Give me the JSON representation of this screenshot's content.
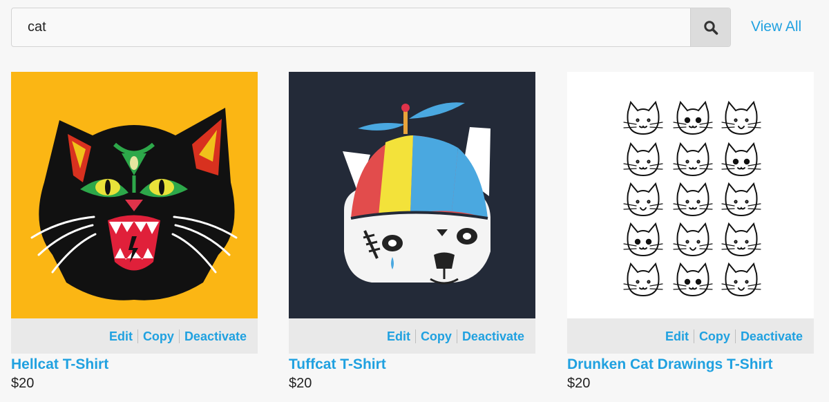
{
  "search": {
    "value": "cat",
    "button_icon": "search-icon"
  },
  "view_all_label": "View All",
  "products": [
    {
      "title": "Hellcat T-Shirt",
      "price": "$20",
      "background": "#fbb614",
      "edit_label": "Edit",
      "copy_label": "Copy",
      "deactivate_label": "Deactivate"
    },
    {
      "title": "Tuffcat T-Shirt",
      "price": "$20",
      "background": "#232a38",
      "edit_label": "Edit",
      "copy_label": "Copy",
      "deactivate_label": "Deactivate"
    },
    {
      "title": "Drunken Cat Drawings T-Shirt",
      "price": "$20",
      "background": "#ffffff",
      "edit_label": "Edit",
      "copy_label": "Copy",
      "deactivate_label": "Deactivate"
    }
  ],
  "colors": {
    "link": "#20a1e0",
    "action_bar": "#e9e9e9",
    "search_button": "#dcdcdc"
  }
}
